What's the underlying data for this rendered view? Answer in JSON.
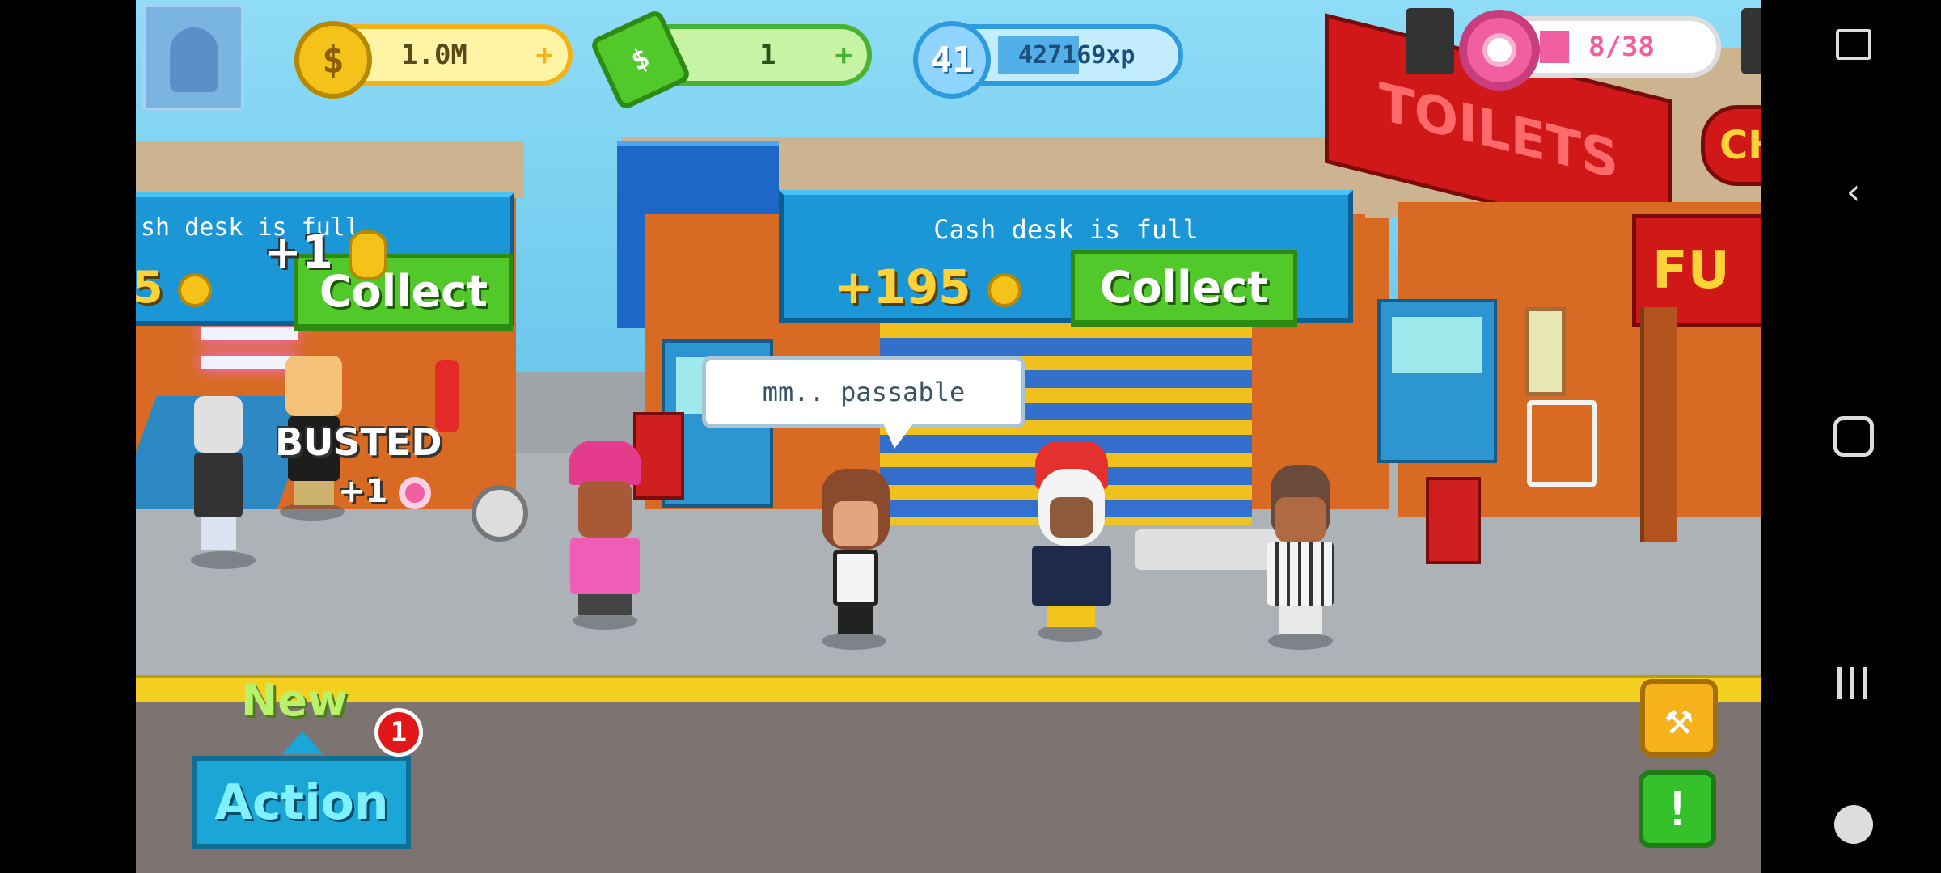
{
  "hud": {
    "coins": "1.0M",
    "cash": "1",
    "level": "41",
    "xp": "427169xp",
    "donuts": "8/38"
  },
  "left_cash_desk": {
    "status_partial": "sh desk is full",
    "amount_partial": "5",
    "collect_label": "Collect",
    "float_coin": "+1",
    "busted_text": "BUSTED",
    "float_donut": "+1"
  },
  "center_cash_desk": {
    "status": "Cash desk is full",
    "amount": "+195",
    "collect_label": "Collect"
  },
  "speech_bubble": "mm.. passable",
  "building_signs": {
    "toilets": "TOILETS",
    "fun_partial": "FU",
    "right_partial": "CH"
  },
  "action_panel": {
    "new_label": "New",
    "action_label": "Action",
    "badge_count": "1"
  },
  "colors": {
    "coin": "#f5c21a",
    "cash": "#49b233",
    "xp": "#2e9be0",
    "donut": "#f25fa0",
    "collect": "#52c92a"
  },
  "icons": [
    "coin-icon",
    "cash-icon",
    "xp-plane-icon",
    "donut-icon",
    "wrench-icon",
    "alert-icon"
  ],
  "nav": {
    "icons": [
      "screen-touch-icon",
      "back-icon",
      "home-icon",
      "recents-icon",
      "gamepad-icon"
    ]
  }
}
